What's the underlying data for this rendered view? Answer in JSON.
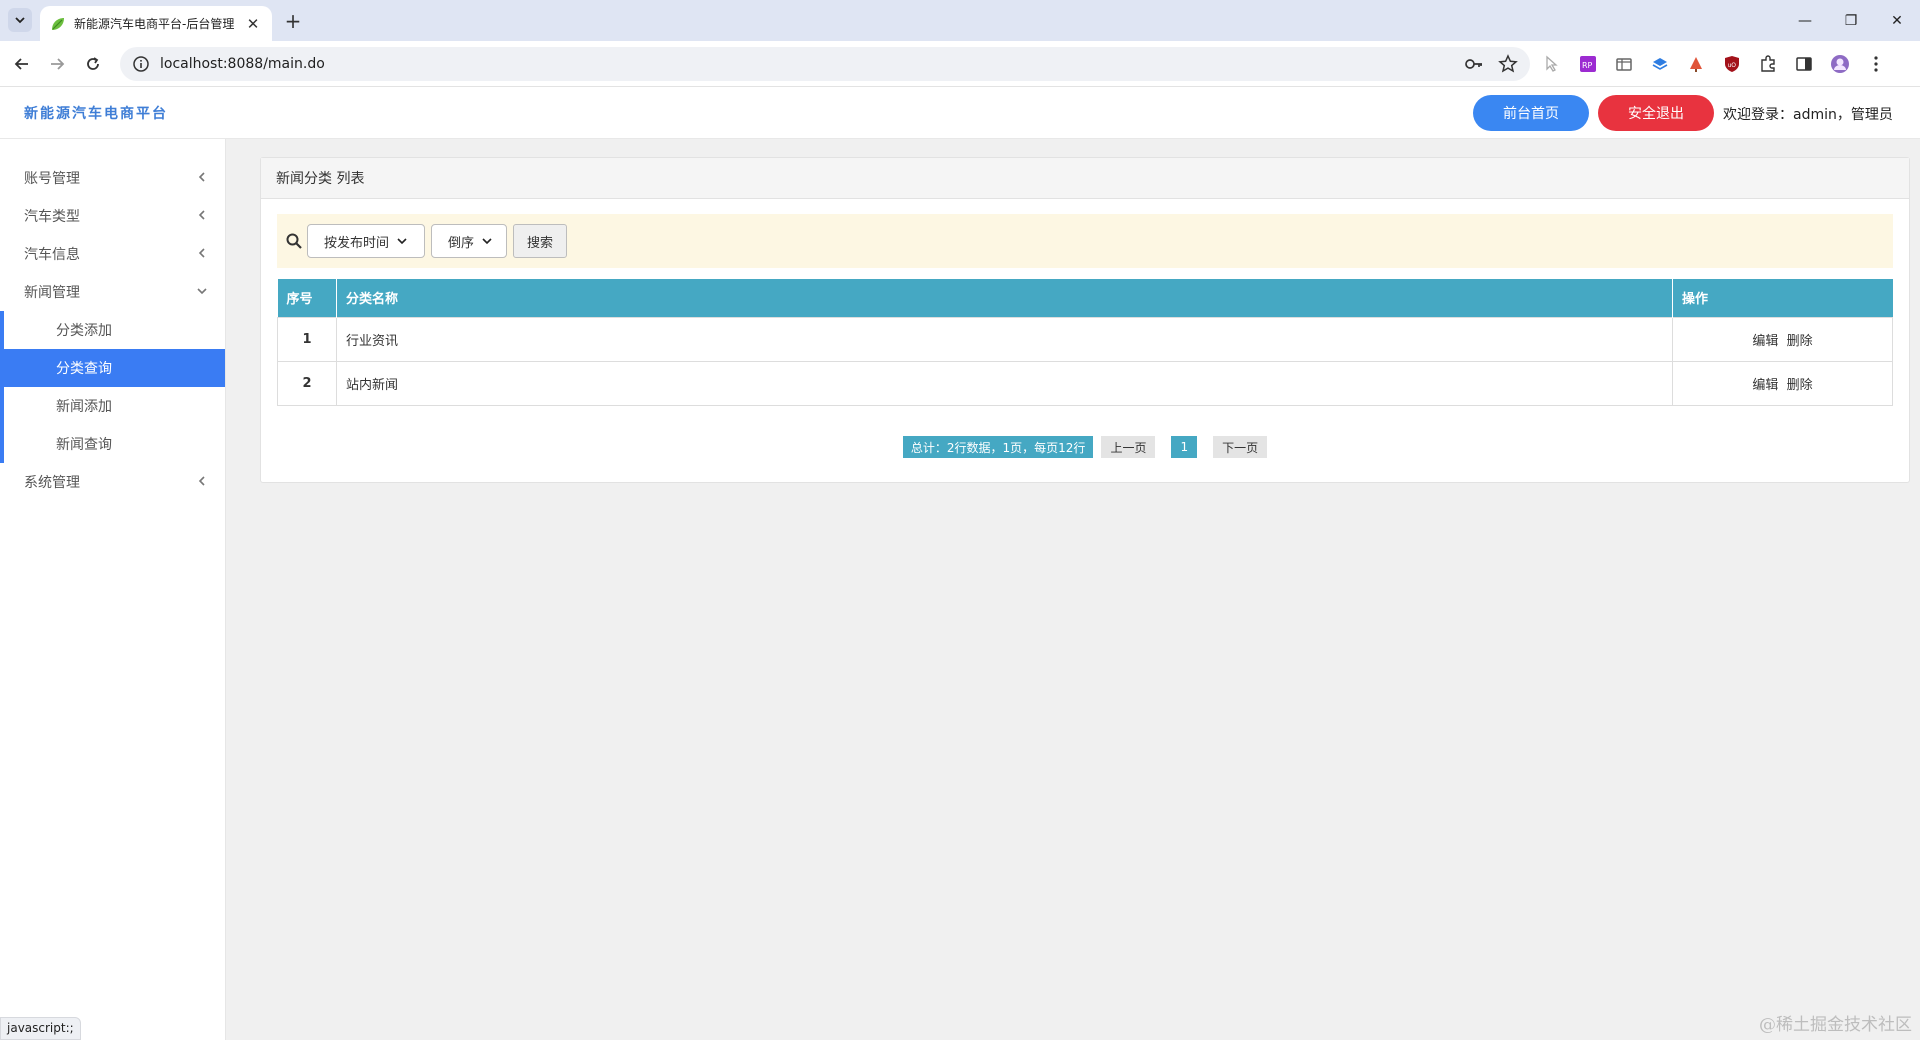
{
  "browser": {
    "tab_title": "新能源汽车电商平台-后台管理",
    "url": "localhost:8088/main.do"
  },
  "header": {
    "brand": "新能源汽车电商平台",
    "home_button": "前台首页",
    "logout_button": "安全退出",
    "welcome": "欢迎登录：admin，管理员"
  },
  "sidebar": {
    "groups": [
      {
        "label": "账号管理"
      },
      {
        "label": "汽车类型"
      },
      {
        "label": "汽车信息"
      },
      {
        "label": "新闻管理"
      },
      {
        "label": "系统管理"
      }
    ],
    "news_items": [
      {
        "label": "分类添加"
      },
      {
        "label": "分类查询"
      },
      {
        "label": "新闻添加"
      },
      {
        "label": "新闻查询"
      }
    ]
  },
  "panel": {
    "title": "新闻分类 列表",
    "sort_field": "按发布时间",
    "sort_order": "倒序",
    "search_button": "搜索",
    "columns": [
      "序号",
      "分类名称",
      "操作"
    ],
    "rows": [
      {
        "idx": "1",
        "name": "行业资讯",
        "edit": "编辑",
        "delete": "删除"
      },
      {
        "idx": "2",
        "name": "站内新闻",
        "edit": "编辑",
        "delete": "删除"
      }
    ],
    "pager": {
      "summary": "总计：2行数据，1页，每页12行",
      "prev": "上一页",
      "current": "1",
      "next": "下一页"
    }
  },
  "status_bar": "javascript:;",
  "watermark": "@稀土掘金技术社区",
  "colors": {
    "accent_blue": "#3a7cf3",
    "table_header": "#45a8c3",
    "logout_red": "#e8333f",
    "search_bg": "#fdf7e3"
  }
}
